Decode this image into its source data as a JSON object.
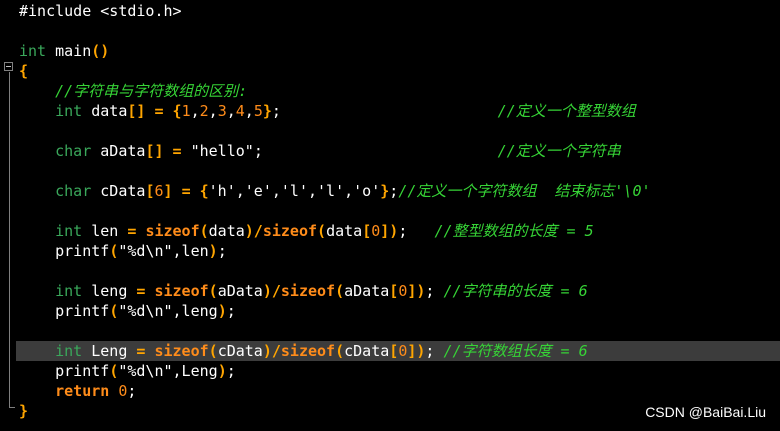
{
  "editor": {
    "lines": [
      {
        "t": "#include <stdio.h>"
      },
      {
        "t": ""
      },
      {
        "t": "int main()"
      },
      {
        "t": "{"
      },
      {
        "t": "    //字符串与字符数组的区别:"
      },
      {
        "t": "    int data[] = {1,2,3,4,5};                        //定义一个整型数组"
      },
      {
        "t": ""
      },
      {
        "t": "    char aData[] = \"hello\";                          //定义一个字符串"
      },
      {
        "t": ""
      },
      {
        "t": "    char cData[6] = {'h','e','l','l','o'};//定义一个字符数组  结束标志'\\0'"
      },
      {
        "t": ""
      },
      {
        "t": "    int len = sizeof(data)/sizeof(data[0]);   //整型数组的长度 = 5"
      },
      {
        "t": "    printf(\"%d\\n\",len);"
      },
      {
        "t": ""
      },
      {
        "t": "    int leng = sizeof(aData)/sizeof(aData[0]); //字符串的长度 = 6"
      },
      {
        "t": "    printf(\"%d\\n\",leng);"
      },
      {
        "t": ""
      },
      {
        "t": "    int Leng = sizeof(cData)/sizeof(cData[0]); //字符数组长度 = 6"
      },
      {
        "t": "    printf(\"%d\\n\",Leng);"
      },
      {
        "t": "    return 0;"
      },
      {
        "t": "}"
      }
    ],
    "highlighted_line": 17
  },
  "watermark": "CSDN @BaiBai.Liu",
  "colors": {
    "background": "#000000",
    "keyword": "#3aa85b",
    "operator": "#ffa500",
    "comment": "#36d436",
    "current_line": "#3c3c3c"
  }
}
